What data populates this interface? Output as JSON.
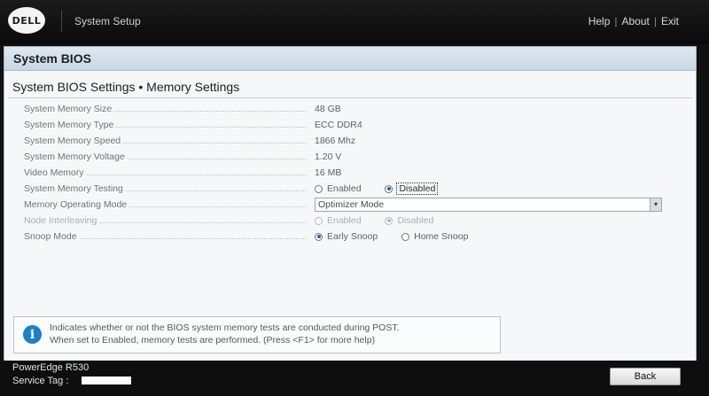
{
  "header": {
    "logo_text": "DELL",
    "app_title": "System Setup",
    "links": {
      "help": "Help",
      "about": "About",
      "exit": "Exit",
      "separator": "|"
    }
  },
  "section": {
    "title": "System BIOS"
  },
  "page": {
    "subtitle": "System BIOS Settings • Memory Settings"
  },
  "settings": [
    {
      "label": "System Memory Size",
      "value": "48 GB"
    },
    {
      "label": "System Memory Type",
      "value": "ECC DDR4"
    },
    {
      "label": "System Memory Speed",
      "value": "1866 Mhz"
    },
    {
      "label": "System Memory Voltage",
      "value": "1.20 V"
    },
    {
      "label": "Video Memory",
      "value": "16 MB"
    },
    {
      "label": "System Memory Testing",
      "options": [
        "Enabled",
        "Disabled"
      ],
      "selected": "Disabled"
    },
    {
      "label": "Memory Operating Mode",
      "selected": "Optimizer Mode"
    },
    {
      "label": "Node Interleaving",
      "options": [
        "Enabled",
        "Disabled"
      ],
      "selected": "Disabled",
      "disabled": true
    },
    {
      "label": "Snoop Mode",
      "options": [
        "Early Snoop",
        "Home Snoop"
      ],
      "selected": "Early Snoop"
    }
  ],
  "help": {
    "icon": "info-icon",
    "line1": "Indicates whether or not the BIOS system memory tests are conducted during POST.",
    "line2": "When set to Enabled, memory tests are performed. (Press <F1> for more help)"
  },
  "footer": {
    "model": "PowerEdge R530",
    "service_tag_label": "Service Tag :",
    "back_label": "Back"
  },
  "colors": {
    "accent": "#1f7fc4",
    "section_bar": "#c9d7e5",
    "background": "#f6f7f8"
  }
}
